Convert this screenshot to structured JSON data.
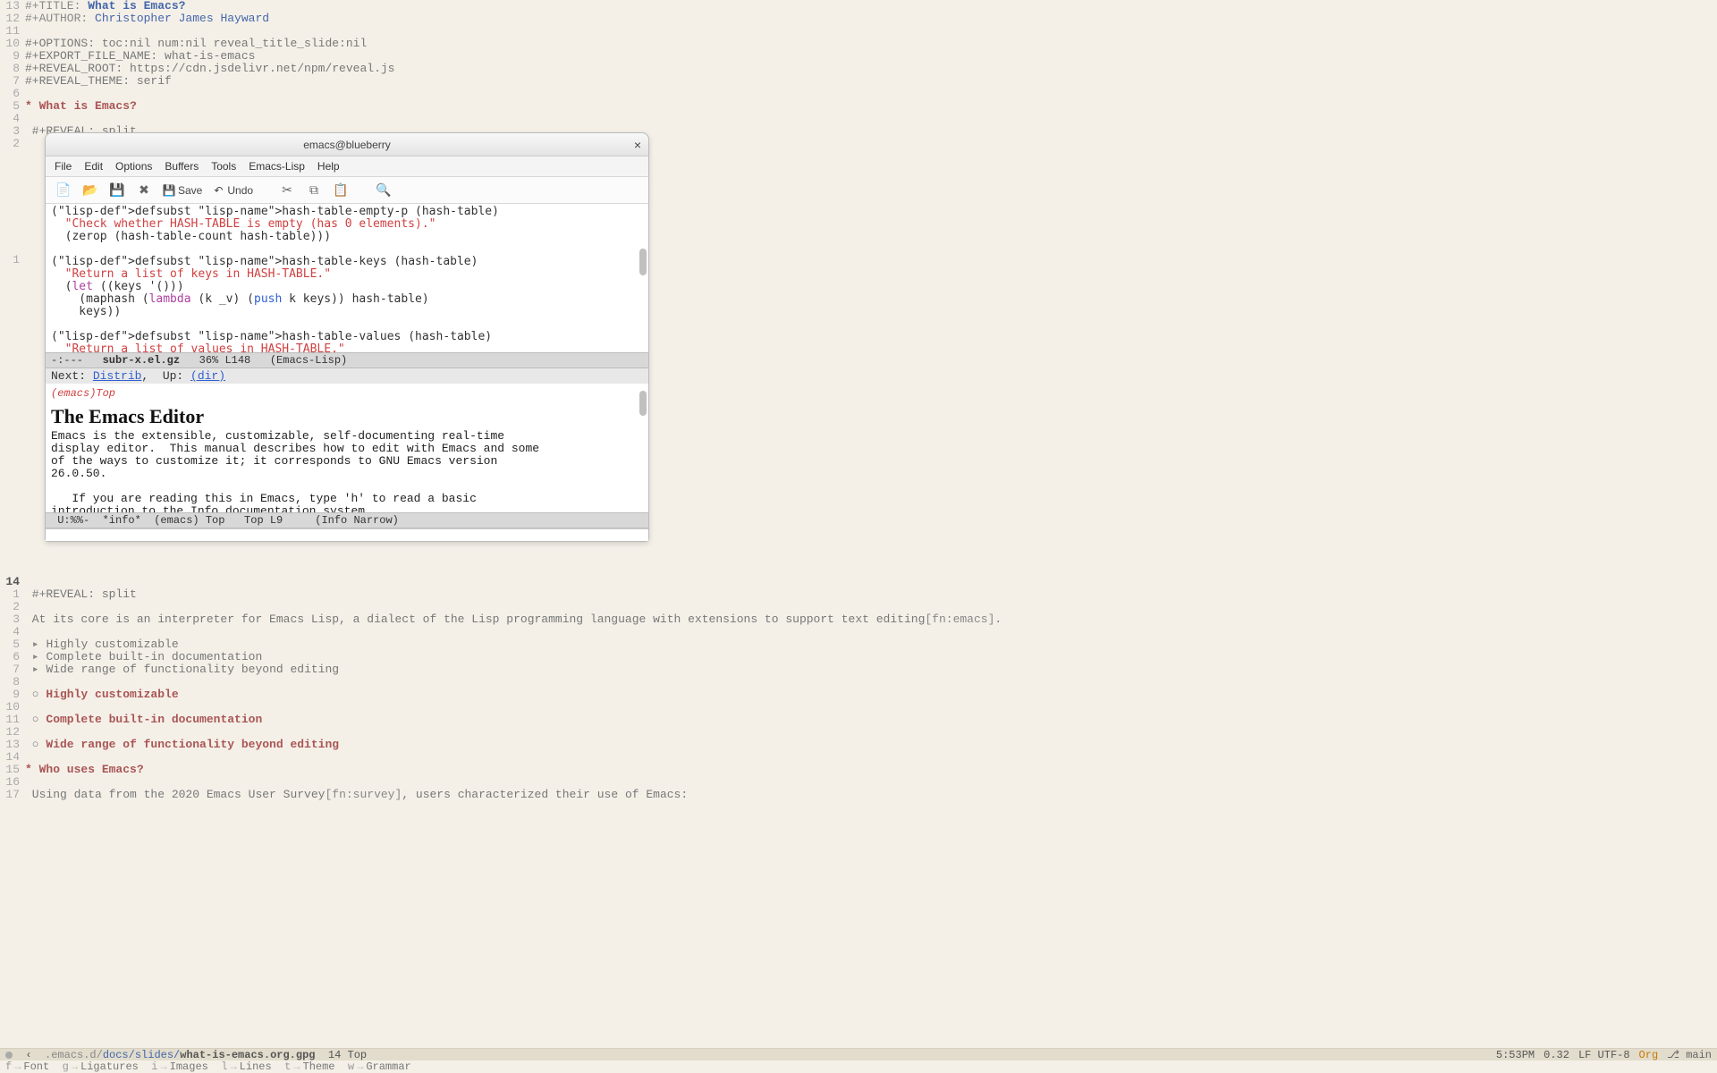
{
  "outer": {
    "lines": [
      {
        "n": 13,
        "type": "kv",
        "key": "#+TITLE:",
        "val": "What is Emacs?",
        "valClass": "title-val"
      },
      {
        "n": 12,
        "type": "kv",
        "key": "#+AUTHOR:",
        "val": "Christopher James Hayward",
        "valClass": "author-val"
      },
      {
        "n": 11,
        "type": "blank"
      },
      {
        "n": 10,
        "type": "plain",
        "text": "#+OPTIONS: toc:nil num:nil reveal_title_slide:nil"
      },
      {
        "n": 9,
        "type": "plain",
        "text": "#+EXPORT_FILE_NAME: what-is-emacs"
      },
      {
        "n": 8,
        "type": "plain",
        "text": "#+REVEAL_ROOT: https://cdn.jsdelivr.net/npm/reveal.js"
      },
      {
        "n": 7,
        "type": "plain",
        "text": "#+REVEAL_THEME: serif"
      },
      {
        "n": 6,
        "type": "blank"
      },
      {
        "n": 5,
        "type": "h1",
        "text": "* What is Emacs?"
      },
      {
        "n": 4,
        "type": "blank"
      },
      {
        "n": 3,
        "type": "plain",
        "text": " #+REVEAL: split"
      },
      {
        "n": 2,
        "type": "blank"
      }
    ],
    "cursor_line": {
      "n": 1,
      "current": true
    },
    "after_lines_block1": [
      {
        "n": 14,
        "type": "blank",
        "current": true
      },
      {
        "n": 1,
        "type": "plain",
        "text": " #+REVEAL: split"
      },
      {
        "n": 2,
        "type": "blank"
      },
      {
        "n": 3,
        "type": "fn",
        "pre": " At its core is an interpreter for Emacs Lisp, a dialect of the Lisp programming language with extensions to support text editing",
        "fn": "[fn:emacs]",
        "post": "."
      },
      {
        "n": 4,
        "type": "blank"
      },
      {
        "n": 5,
        "type": "li",
        "text": "Highly customizable"
      },
      {
        "n": 6,
        "type": "li",
        "text": "Complete built-in documentation"
      },
      {
        "n": 7,
        "type": "li",
        "text": "Wide range of functionality beyond editing"
      },
      {
        "n": 8,
        "type": "blank"
      },
      {
        "n": 9,
        "type": "sub",
        "text": "Highly customizable"
      },
      {
        "n": 10,
        "type": "blank"
      },
      {
        "n": 11,
        "type": "sub",
        "text": "Complete built-in documentation"
      },
      {
        "n": 12,
        "type": "blank"
      },
      {
        "n": 13,
        "type": "sub",
        "text": "Wide range of functionality beyond editing"
      },
      {
        "n": 14,
        "type": "blank"
      },
      {
        "n": 15,
        "type": "h1",
        "text": "* Who uses Emacs?"
      },
      {
        "n": 16,
        "type": "blank"
      },
      {
        "n": 17,
        "type": "fn",
        "pre": " Using data from the 2020 Emacs User Survey",
        "fn": "[fn:survey]",
        "post": ", users characterized their use of Emacs:"
      }
    ]
  },
  "window": {
    "title": "emacs@blueberry",
    "menus": [
      "File",
      "Edit",
      "Options",
      "Buffers",
      "Tools",
      "Emacs-Lisp",
      "Help"
    ],
    "toolbar": {
      "save_label": "Save",
      "undo_label": "Undo"
    },
    "lisp_code": "(defsubst hash-table-empty-p (hash-table)\n  \"Check whether HASH-TABLE is empty (has 0 elements).\"\n  (zerop (hash-table-count hash-table)))\n\n(defsubst hash-table-keys (hash-table)\n  \"Return a list of keys in HASH-TABLE.\"\n  (let ((keys '()))\n    (maphash (lambda (k _v) (push k keys)) hash-table)\n    keys))\n\n(defsubst hash-table-values (hash-table)\n  \"Return a list of values in HASH-TABLE.\"\n  (let ((values '()))",
    "modeline1": {
      "left": "-:---   ",
      "file": "subr-x.el.gz",
      "rest": "   36% L148   (Emacs-Lisp)"
    },
    "nav": {
      "prefix": "Next: ",
      "link1": "Distrib",
      "mid": ",  Up: ",
      "link2": "(dir)"
    },
    "info_node": "(emacs)Top",
    "info_h1": "The Emacs Editor",
    "info_body": "Emacs is the extensible, customizable, self-documenting real-time\ndisplay editor.  This manual describes how to edit with Emacs and some\nof the ways to customize it; it corresponds to GNU Emacs version\n26.0.50.\n\n   If you are reading this in Emacs, type 'h' to read a basic\nintroduction to the Info documentation system.",
    "modeline2": " U:%%-  *info*  (emacs) Top   Top L9     (Info Narrow)"
  },
  "status": {
    "path_dim": ".emacs.d/",
    "path_mid": "docs/slides/",
    "path_file": "what-is-emacs.org.gpg",
    "pos": "  14 Top",
    "time": "5:53PM",
    "load": "0.32",
    "enc": "LF UTF-8",
    "mode": "Org",
    "branch": "main"
  },
  "hints": [
    {
      "k": "f",
      "label": "Font"
    },
    {
      "k": "g",
      "label": "Ligatures"
    },
    {
      "k": "i",
      "label": "Images"
    },
    {
      "k": "l",
      "label": "Lines"
    },
    {
      "k": "t",
      "label": "Theme"
    },
    {
      "k": "w",
      "label": "Grammar"
    }
  ]
}
